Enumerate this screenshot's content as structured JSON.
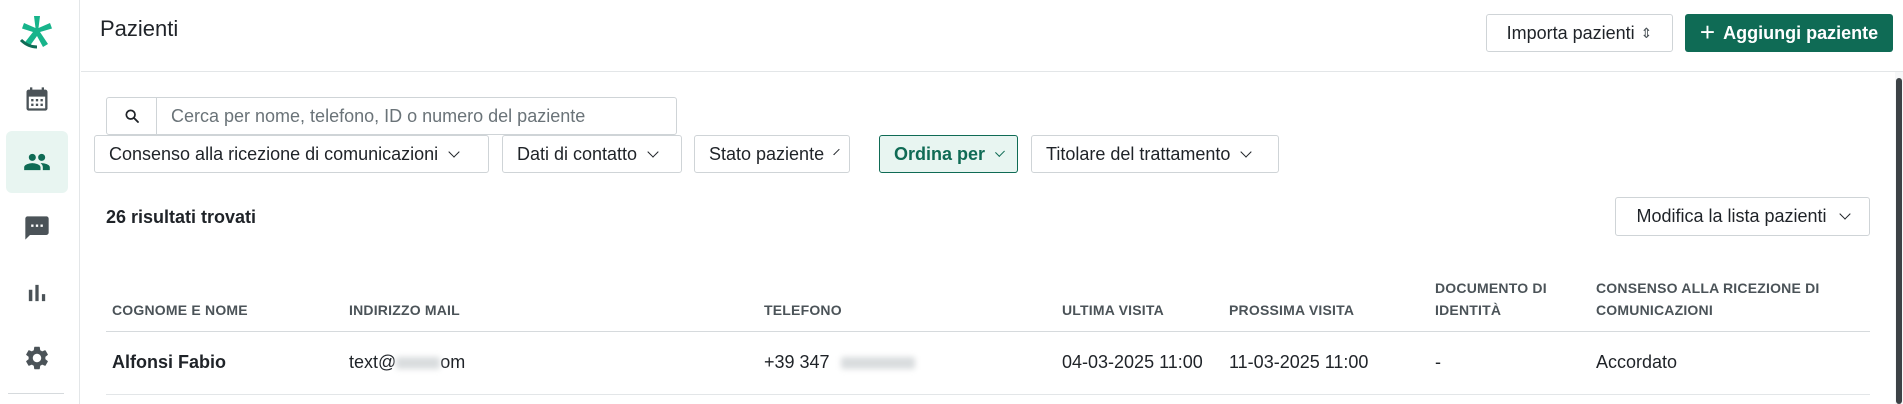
{
  "sidebar": {
    "items": [
      {
        "name": "calendar",
        "icon": "calendar-icon"
      },
      {
        "name": "patients",
        "icon": "patients-icon",
        "active": true
      },
      {
        "name": "messages",
        "icon": "chat-icon"
      },
      {
        "name": "statistics",
        "icon": "bar-chart-icon"
      },
      {
        "name": "settings",
        "icon": "gear-icon"
      }
    ]
  },
  "header": {
    "title": "Pazienti",
    "import_label": "Importa pazienti",
    "add_label": "Aggiungi paziente"
  },
  "search": {
    "placeholder": "Cerca per nome, telefono, ID o numero del paziente",
    "value": ""
  },
  "filters": [
    {
      "label": "Consenso alla ricezione di comunicazioni"
    },
    {
      "label": "Dati di contatto"
    },
    {
      "label": "Stato paziente"
    },
    {
      "label": "Ordina per",
      "active": true
    },
    {
      "label": "Titolare del trattamento"
    }
  ],
  "results": {
    "count_text": "26 risultati trovati",
    "edit_list_label": "Modifica la lista pazienti"
  },
  "table": {
    "headers": {
      "name": "COGNOME E NOME",
      "email": "INDIRIZZO MAIL",
      "phone": "TELEFONO",
      "last_visit": "ULTIMA VISITA",
      "next_visit": "PROSSIMA VISITA",
      "id_doc_1": "DOCUMENTO DI",
      "id_doc_2": "IDENTITÀ",
      "consent_1": "CONSENSO ALLA RICEZIONE DI",
      "consent_2": "COMUNICAZIONI"
    },
    "rows": [
      {
        "name": "Alfonsi Fabio",
        "email_prefix": "text@",
        "email_suffix": "om",
        "phone_prefix": "+39 347",
        "last_visit": "04-03-2025 11:00",
        "next_visit": "11-03-2025 11:00",
        "id_document": "-",
        "consent": "Accordato"
      }
    ]
  },
  "colors": {
    "brand": "#0f6b55",
    "active_bg": "#e8f5f1",
    "border": "#cfd4d7"
  }
}
